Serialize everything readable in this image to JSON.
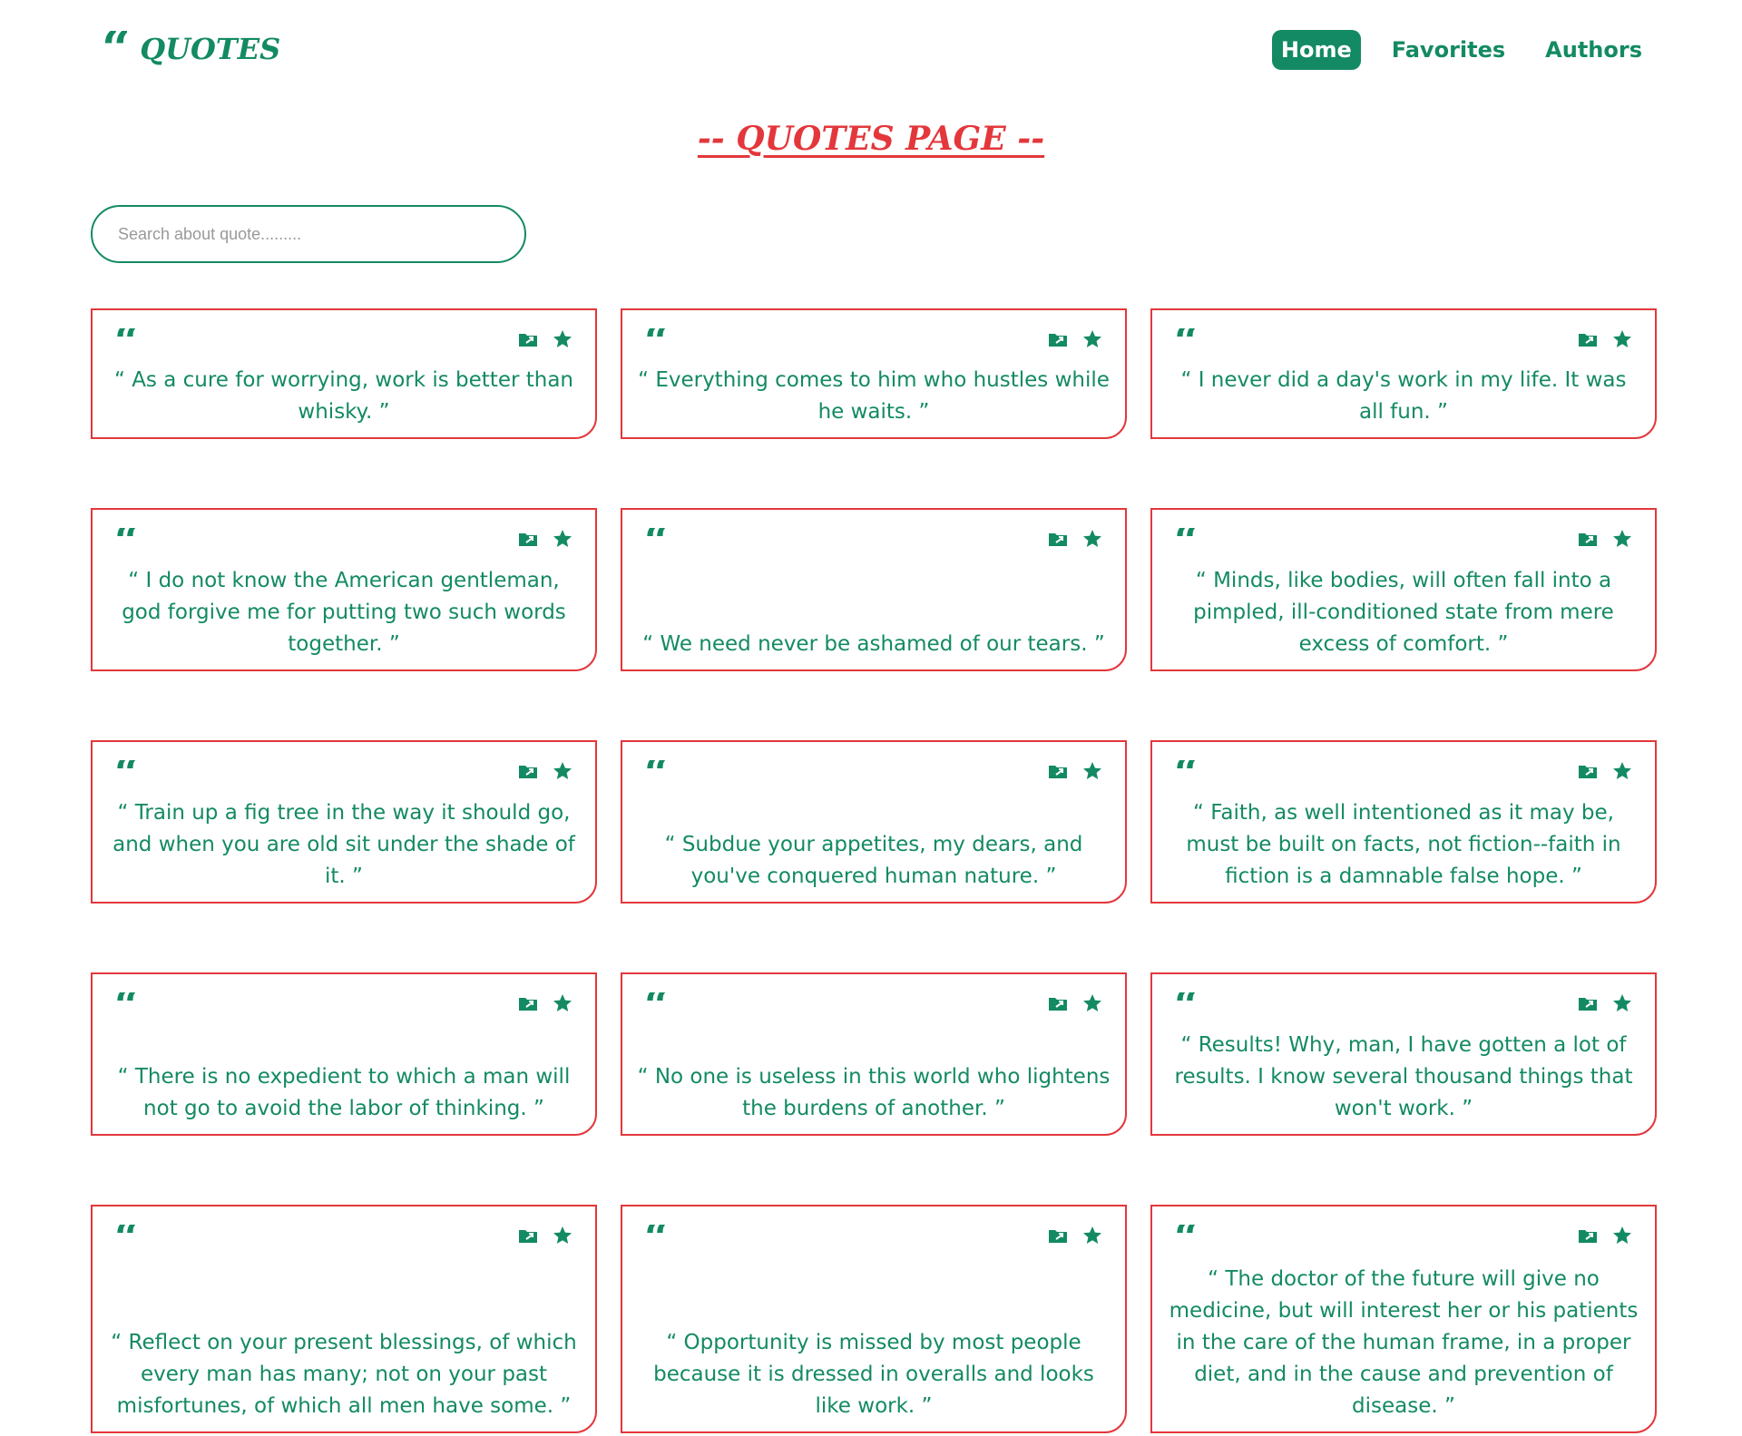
{
  "brand": {
    "icon": "quote-left-icon",
    "glyph": "“",
    "title": "QUOTES"
  },
  "nav": {
    "items": [
      {
        "label": "Home",
        "active": true
      },
      {
        "label": "Favorites",
        "active": false
      },
      {
        "label": "Authors",
        "active": false
      }
    ]
  },
  "page_title": "-- QUOTES PAGE --",
  "search": {
    "placeholder": "Search about quote.........",
    "value": ""
  },
  "card_icons": {
    "quote": "quote-left-icon",
    "quote_glyph": "“",
    "share": "folder-share-icon",
    "favorite": "star-icon"
  },
  "quotes": [
    "“ As a cure for worrying, work is better than whisky. ”",
    "“ Everything comes to him who hustles while he waits. ”",
    "“ I never did a day's work in my life. It was all fun. ”",
    "“ I do not know the American gentleman, god forgive me for putting two such words together. ”",
    "“ We need never be ashamed of our tears. ”",
    "“ Minds, like bodies, will often fall into a pimpled, ill-conditioned state from mere excess of comfort. ”",
    "“ Train up a fig tree in the way it should go, and when you are old sit under the shade of it. ”",
    "“ Subdue your appetites, my dears, and you've conquered human nature. ”",
    "“ Faith, as well intentioned as it may be, must be built on facts, not fiction--faith in fiction is a damnable false hope. ”",
    "“ There is no expedient to which a man will not go to avoid the labor of thinking. ”",
    "“ No one is useless in this world who lightens the burdens of another. ”",
    "“ Results! Why, man, I have gotten a lot of results. I know several thousand things that won't work. ”",
    "“ Reflect on your present blessings, of which every man has many; not on your past misfortunes, of which all men have some. ”",
    "“ Opportunity is missed by most people because it is dressed in overalls and looks like work. ”",
    "“ The doctor of the future will give no medicine, but will interest her or his patients in the care of the human frame, in a proper diet, and in the cause and prevention of disease. ”"
  ],
  "colors": {
    "primary": "#138a63",
    "accent": "#e3373b",
    "background": "#ffffff"
  }
}
